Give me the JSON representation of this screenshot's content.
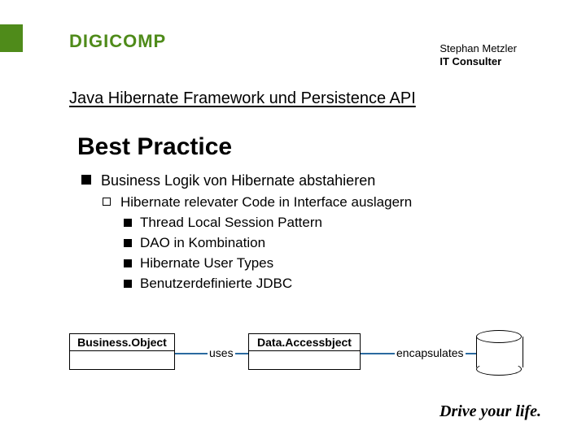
{
  "logo": "DIGICOMP",
  "author": {
    "name": "Stephan Metzler",
    "title": "IT Consulter"
  },
  "course": "Java Hibernate Framework und Persistence API",
  "slide_title": "Best Practice",
  "bullets": {
    "l1": "Business Logik von Hibernate abstahieren",
    "l2": "Hibernate relevater Code in Interface auslagern",
    "l3a": "Thread Local Session Pattern",
    "l3b": "DAO in Kombination",
    "l3c": "Hibernate User Types",
    "l3d": "Benutzerdefinierte JDBC"
  },
  "diagram": {
    "box1": "Business.Object",
    "rel1": "uses",
    "box2": "Data.Accessbject",
    "rel2": "encapsulates"
  },
  "tagline": "Drive your life."
}
